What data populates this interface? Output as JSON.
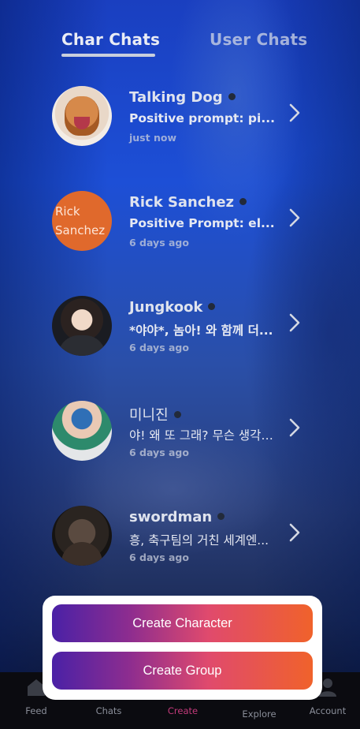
{
  "tabs": [
    {
      "label": "Char Chats",
      "active": true
    },
    {
      "label": "User Chats",
      "active": false
    }
  ],
  "chats": [
    {
      "name": "Talking Dog",
      "preview": "Positive prompt: pi...",
      "time": "just now",
      "avatar": "dog-avatar"
    },
    {
      "name": "Rick Sanchez",
      "preview": "Positive Prompt: el...",
      "time": "6 days ago",
      "avatar_text": [
        "Rick",
        "Sanchez"
      ],
      "avatar_color": "#e0692c"
    },
    {
      "name": "Jungkook",
      "preview": "*야야*, 놈아! 와 함께 더...",
      "time": "6 days ago",
      "avatar": "person-avatar"
    },
    {
      "name": "미니진",
      "preview": "야! 왜 또 그래? 무슨 생각…",
      "time": "6 days ago",
      "avatar": "person-avatar"
    },
    {
      "name": "swordman",
      "preview": "흥, 축구팀의 거친 세계엔...",
      "time": "6 days ago",
      "avatar": "warrior-avatar"
    }
  ],
  "actions": {
    "create_character": "Create Character",
    "create_group": "Create Group"
  },
  "bottom_nav": [
    {
      "label": "Feed",
      "icon": "home-icon"
    },
    {
      "label": "Chats",
      "icon": "chat-icon"
    },
    {
      "label": "Create",
      "icon": "create-icon",
      "active": true
    },
    {
      "label": "Explore",
      "icon": "compass-icon"
    },
    {
      "label": "Account",
      "icon": "user-icon"
    }
  ],
  "colors": {
    "accent_gradient_start": "#4a21a6",
    "accent_gradient_end": "#f0622b",
    "nav_active": "#c23a7a"
  }
}
